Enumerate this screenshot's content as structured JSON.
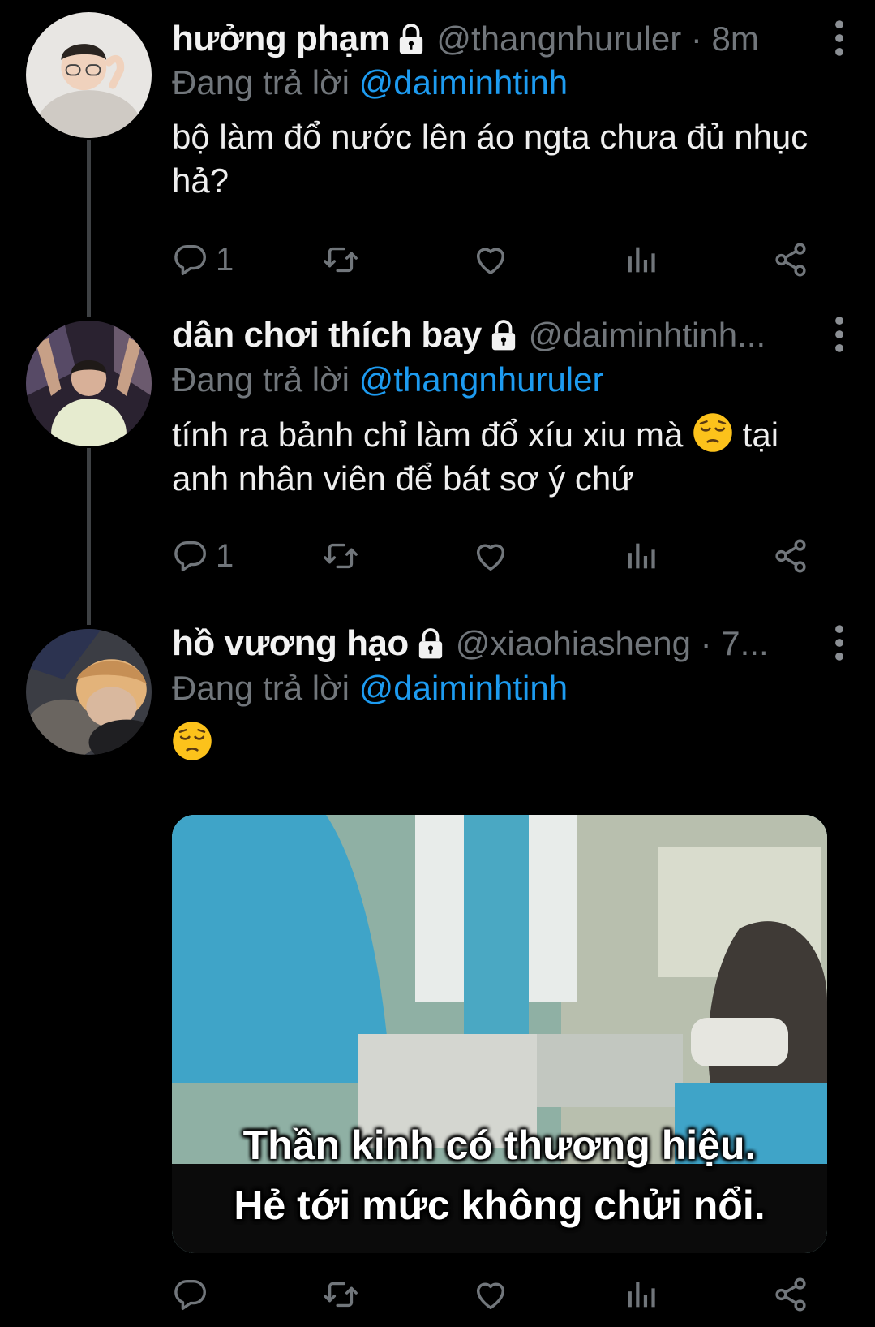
{
  "tweets": [
    {
      "name": "hưởng phạm",
      "handle": "@thangnhuruler",
      "time": "8m",
      "reply_prefix": "Đang trả lời",
      "reply_to": "@daiminhtinh",
      "text": "bộ làm đổ nước lên áo ngta chưa đủ nhục hả?",
      "replies": "1"
    },
    {
      "name": "dân chơi thích bay",
      "handle": "@daiminhtinh...",
      "reply_prefix": "Đang trả lời",
      "reply_to": "@thangnhuruler",
      "text_a": "tính ra bảnh chỉ làm đổ xíu xiu mà",
      "text_b": "tại anh nhân viên để bát sơ ý chứ",
      "replies": "1"
    },
    {
      "name": "hồ vương hạo",
      "handle": "@xiaohiasheng",
      "time": "7...",
      "reply_prefix": "Đang trả lời",
      "reply_to": "@daiminhtinh",
      "media_caption_1": "Thần kinh có thương hiệu.",
      "media_caption_2": "Hẻ tới mức không chửi nổi."
    }
  ],
  "icons": {
    "reply": "reply-icon",
    "retweet": "retweet-icon",
    "like": "heart-icon",
    "views": "analytics-icon",
    "share": "share-icon",
    "lock": "lock-icon",
    "more": "more-icon",
    "emoji": "pensive-face-emoji"
  },
  "colors": {
    "background": "#000000",
    "secondary_text": "#71767b",
    "link": "#1d9bf0",
    "thread_line": "#3e4144"
  }
}
